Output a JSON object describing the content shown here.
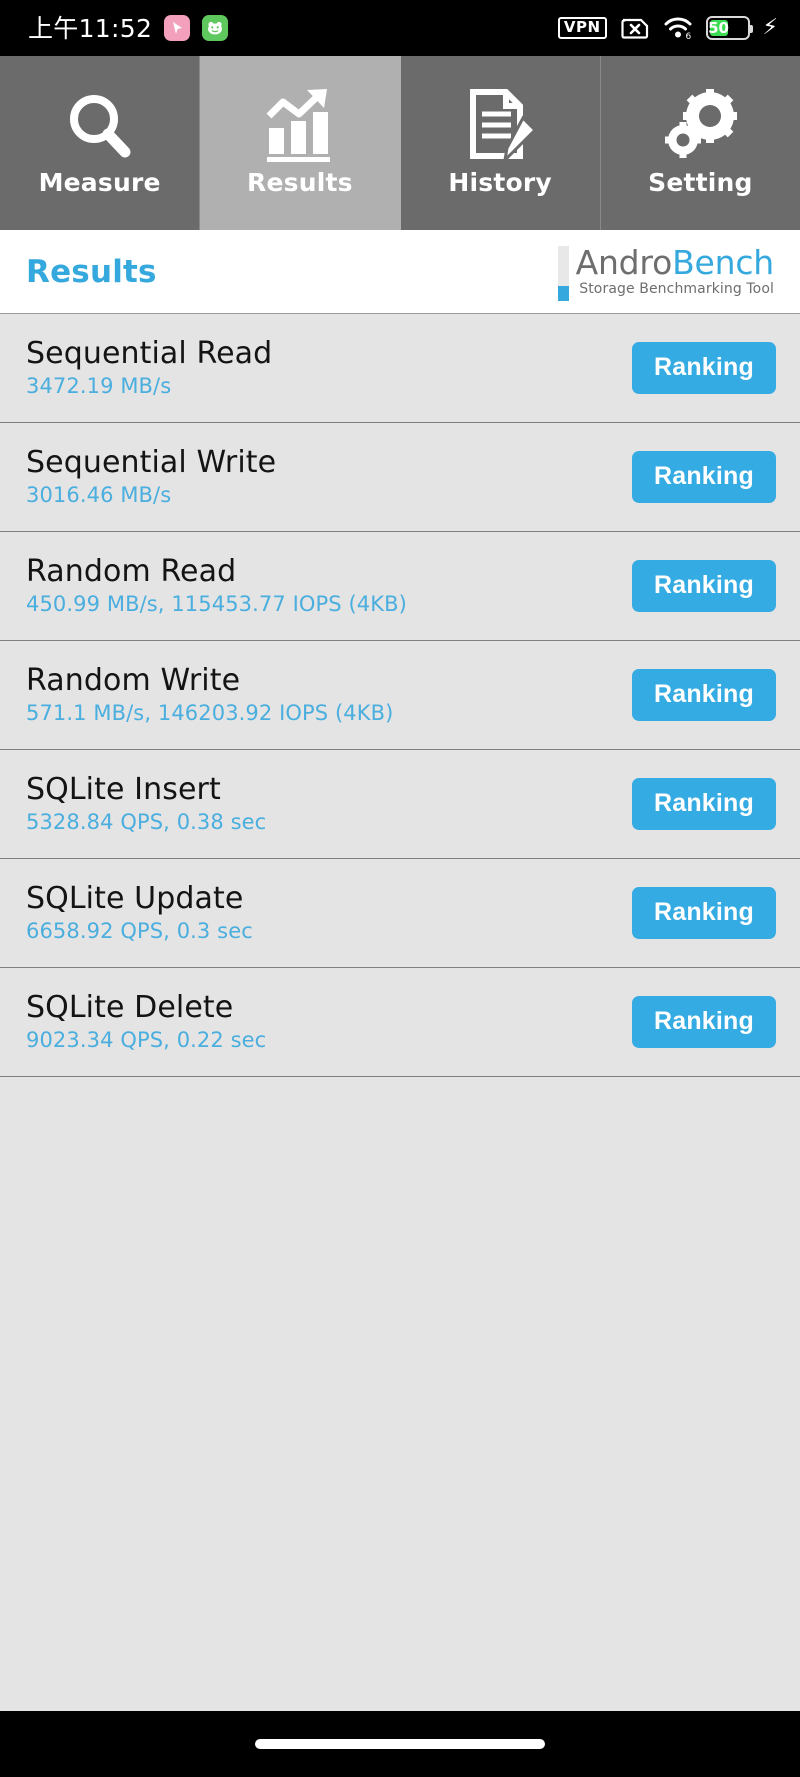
{
  "statusbar": {
    "clock": "上午11:52",
    "app_icons": [
      {
        "name": "pink-app-icon",
        "glyph": "➤"
      },
      {
        "name": "green-app-icon",
        "glyph": "🐸"
      }
    ],
    "vpn_label": "VPN",
    "sim_icon": "sim-card-disabled-icon",
    "wifi_icon": "wifi-6-icon",
    "battery_percent": "50",
    "battery_level": 50,
    "charging_icon": "lightning-bolt-icon"
  },
  "tabs": [
    {
      "label": "Measure",
      "icon": "magnifier-icon",
      "active": false
    },
    {
      "label": "Results",
      "icon": "bar-chart-growth-icon",
      "active": true
    },
    {
      "label": "History",
      "icon": "document-pencil-icon",
      "active": false
    },
    {
      "label": "Setting",
      "icon": "gears-icon",
      "active": false
    }
  ],
  "header": {
    "title": "Results",
    "logo_andro": "Andro",
    "logo_bench": "Bench",
    "logo_subtitle": "Storage Benchmarking Tool"
  },
  "results": [
    {
      "title": "Sequential Read",
      "value": "3472.19 MB/s",
      "button": "Ranking"
    },
    {
      "title": "Sequential Write",
      "value": "3016.46 MB/s",
      "button": "Ranking"
    },
    {
      "title": "Random Read",
      "value": "450.99 MB/s, 115453.77 IOPS (4KB)",
      "button": "Ranking"
    },
    {
      "title": "Random Write",
      "value": "571.1 MB/s, 146203.92 IOPS (4KB)",
      "button": "Ranking"
    },
    {
      "title": "SQLite Insert",
      "value": "5328.84 QPS, 0.38 sec",
      "button": "Ranking"
    },
    {
      "title": "SQLite Update",
      "value": "6658.92 QPS, 0.3 sec",
      "button": "Ranking"
    },
    {
      "title": "SQLite Delete",
      "value": "9023.34 QPS, 0.22 sec",
      "button": "Ranking"
    }
  ],
  "colors": {
    "accent_blue": "#34abe3",
    "value_blue": "#4aaede",
    "tab_inactive": "#6b6b6b",
    "tab_active": "#b0b0b0",
    "list_bg": "#e4e4e4",
    "battery_green": "#3ddc55"
  }
}
